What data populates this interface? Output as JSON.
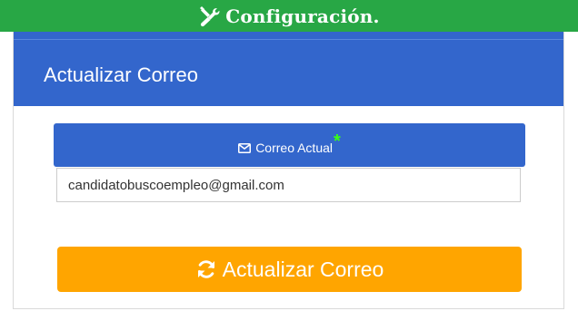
{
  "header": {
    "title": "Configuración.",
    "icon": "tools-icon",
    "background": "#28a745"
  },
  "card": {
    "title": "Actualizar Correo",
    "header_color": "#3366cc"
  },
  "field": {
    "label": "Correo Actual",
    "label_icon": "envelope-icon",
    "required_marker": "*",
    "value": "candidatobuscoempleo@gmail.com"
  },
  "submit": {
    "label": "Actualizar Correo",
    "icon": "refresh-icon",
    "color": "#ffa500"
  }
}
